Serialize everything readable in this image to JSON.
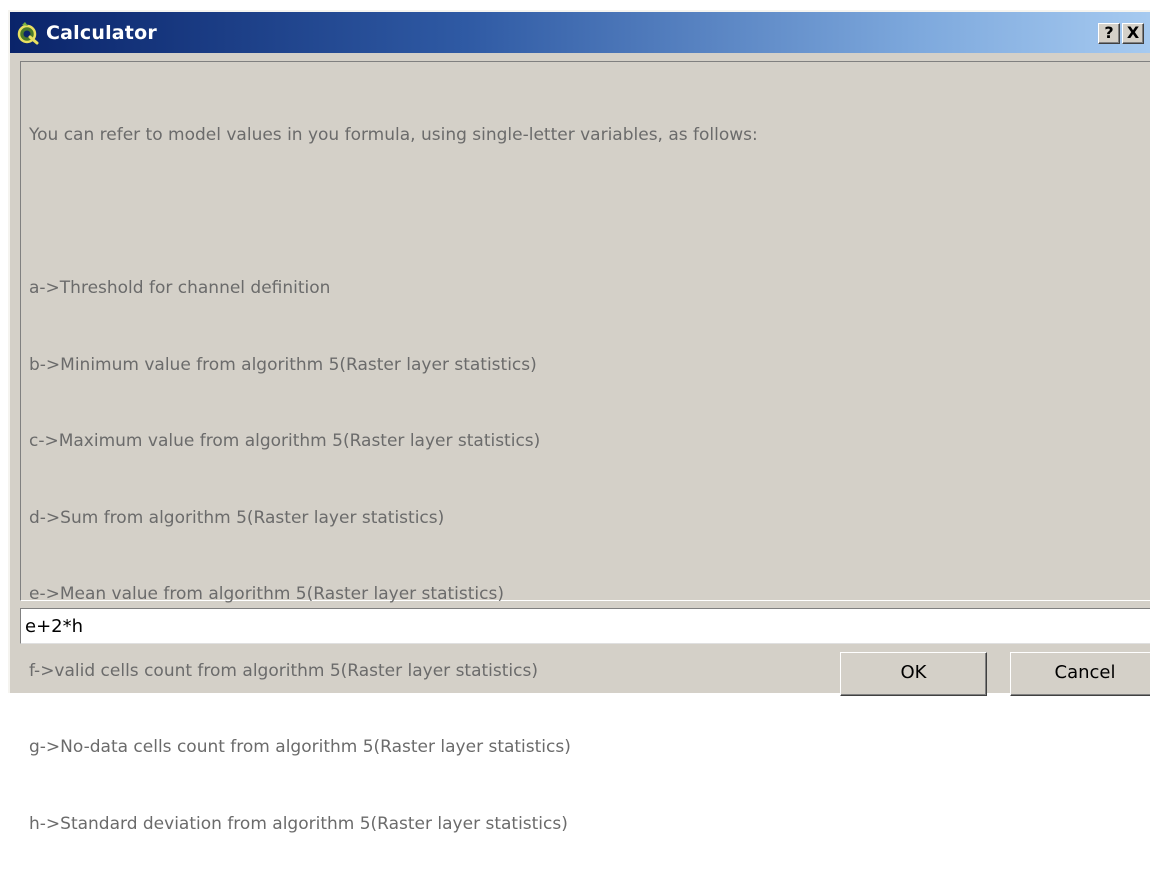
{
  "window": {
    "title": "Calculator",
    "icon": "qgis-icon",
    "help_label": "?",
    "close_label": "X"
  },
  "info": {
    "intro": "You can refer to model values in you formula, using single-letter variables, as follows:",
    "variables": [
      "a->Threshold for channel definition",
      "b->Minimum value from algorithm 5(Raster layer statistics)",
      "c->Maximum value from algorithm 5(Raster layer statistics)",
      "d->Sum from algorithm 5(Raster layer statistics)",
      "e->Mean value from algorithm 5(Raster layer statistics)",
      "f->valid cells count from algorithm 5(Raster layer statistics)",
      "g->No-data cells count from algorithm 5(Raster layer statistics)",
      "h->Standard deviation from algorithm 5(Raster layer statistics)"
    ]
  },
  "formula": {
    "value": "e+2*h"
  },
  "buttons": {
    "ok_label": "OK",
    "cancel_label": "Cancel"
  },
  "colors": {
    "titlebar_start": "#0a246a",
    "titlebar_end": "#a6caf0",
    "dialog_bg": "#d4d0c8",
    "info_text": "#6b6b6b"
  }
}
